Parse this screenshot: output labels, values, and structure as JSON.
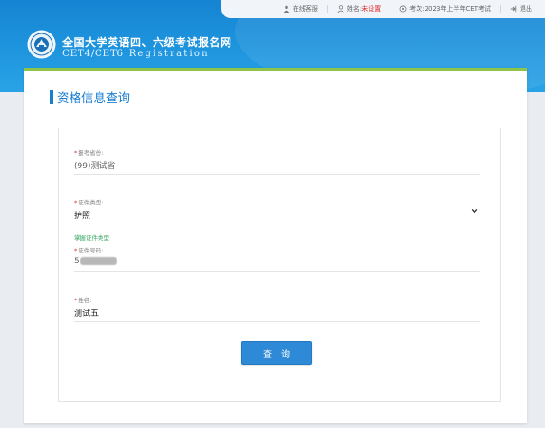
{
  "topbar": {
    "online_service": "在线客服",
    "name_label": "姓名:",
    "name_value": "未设置",
    "exam_label": "考次:",
    "exam_value": "2023年上半年CET考试",
    "logout": "退出"
  },
  "header": {
    "title": "全国大学英语四、六级考试报名网",
    "subtitle": "CET4/CET6",
    "subtitle_reg": "Registration"
  },
  "page": {
    "title": "资格信息查询"
  },
  "form": {
    "province": {
      "label": "报考省份:",
      "value": "(99)测试省"
    },
    "id_type": {
      "label": "证件类型:",
      "value": "护照",
      "hint": "掌握证件类型"
    },
    "id_number": {
      "label": "证件号码:",
      "value_prefix": "5"
    },
    "name": {
      "label": "姓名:",
      "value": "测试五"
    },
    "submit_label": "查询"
  },
  "colors": {
    "header_blue": "#1f95de",
    "accent_green": "#8dc44a",
    "title_blue": "#1b7fd0",
    "button_blue": "#2e8ad6",
    "focus_teal": "#27a8b5",
    "required_red": "#e02b2b"
  },
  "icons": {
    "online_service": "person-icon",
    "name": "user-icon",
    "exam": "exam-icon",
    "logout": "logout-icon",
    "select": "chevron-down-icon",
    "logo": "seal-logo"
  }
}
